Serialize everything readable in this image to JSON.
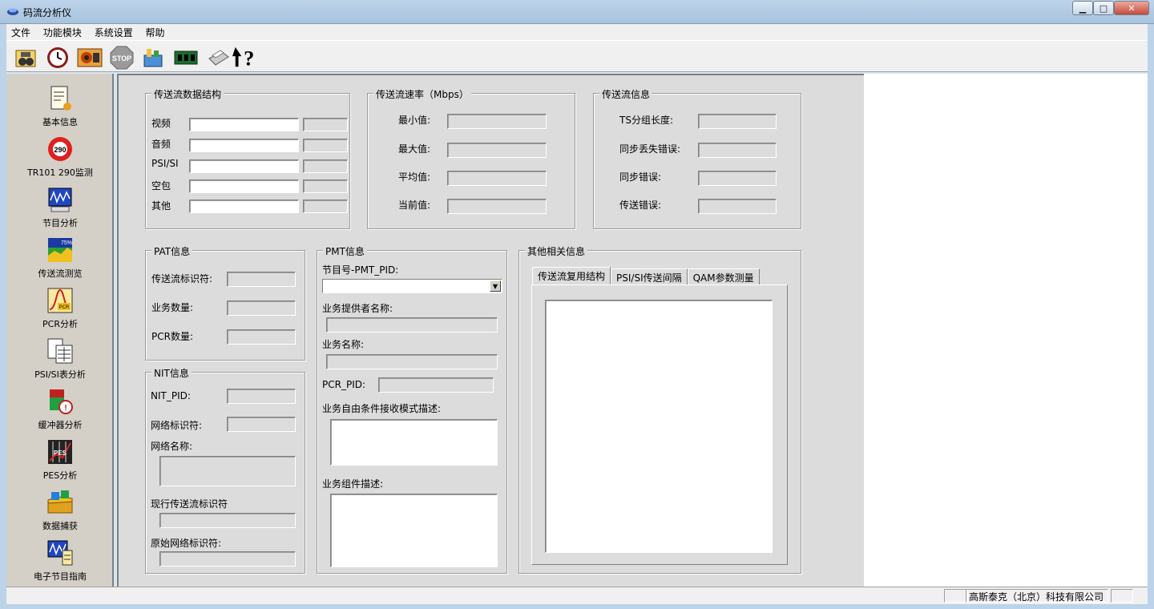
{
  "window": {
    "title": "码流分析仪",
    "minimize": "▁",
    "maximize": "□",
    "close": "✕"
  },
  "menu": [
    "文件",
    "功能模块",
    "系统设置",
    "帮助"
  ],
  "toolbar": [
    "binoculars-icon",
    "clock-icon",
    "record-icon",
    "stop-icon",
    "tools-icon",
    "board-icon",
    "printer-icon",
    "help-icon"
  ],
  "toolbar_stop_text": "STOP",
  "sidebar": [
    {
      "label": "基本信息",
      "icon": "document-icon"
    },
    {
      "label": "TR101 290监测",
      "icon": "tr101-icon",
      "badge": "290"
    },
    {
      "label": "节目分析",
      "icon": "program-analysis-icon"
    },
    {
      "label": "传送流测览",
      "icon": "ts-browse-icon",
      "badge": "75%"
    },
    {
      "label": "PCR分析",
      "icon": "pcr-icon",
      "badge": "PCR"
    },
    {
      "label": "PSI/SI表分析",
      "icon": "psi-table-icon"
    },
    {
      "label": "缓冲器分析",
      "icon": "buffer-icon"
    },
    {
      "label": "PES分析",
      "icon": "pes-icon",
      "badge": "PES"
    },
    {
      "label": "数据捕获",
      "icon": "capture-icon"
    },
    {
      "label": "电子节目指南",
      "icon": "epg-icon"
    }
  ],
  "ts_structure": {
    "title": "传送流数据结构",
    "rows": [
      "视频",
      "音频",
      "PSI/SI",
      "空包",
      "其他"
    ]
  },
  "ts_rate": {
    "title": "传送流速率（Mbps）",
    "rows": [
      "最小值:",
      "最大值:",
      "平均值:",
      "当前值:"
    ]
  },
  "ts_info": {
    "title": "传送流信息",
    "rows": [
      "TS分组长度:",
      "同步丢失错误:",
      "同步错误:",
      "传送错误:"
    ]
  },
  "pat": {
    "title": "PAT信息",
    "rows": [
      "传送流标识符:",
      "业务数量:",
      "PCR数量:"
    ]
  },
  "nit": {
    "title": "NIT信息",
    "pid": "NIT_PID:",
    "network_id": "网络标识符:",
    "network_name": "网络名称:",
    "current_ts_id": "现行传送流标识符",
    "original_network_id": "原始网络标识符:"
  },
  "pmt": {
    "title": "PMT信息",
    "program_pid": "节目号-PMT_PID:",
    "provider": "业务提供者名称:",
    "service_name": "业务名称:",
    "pcr_pid": "PCR_PID:",
    "ca_desc": "业务自由条件接收模式描述:",
    "component_desc": "业务组件描述:"
  },
  "other": {
    "title": "其他相关信息",
    "tabs": [
      "传送流复用结构",
      "PSI/SI传送间隔",
      "QAM参数测量"
    ]
  },
  "status": {
    "company": "高斯泰克（北京）科技有限公司"
  },
  "colors": {
    "panel": "#dcdcdc",
    "frame": "#bcd3ea",
    "close": "#c74a3a"
  }
}
